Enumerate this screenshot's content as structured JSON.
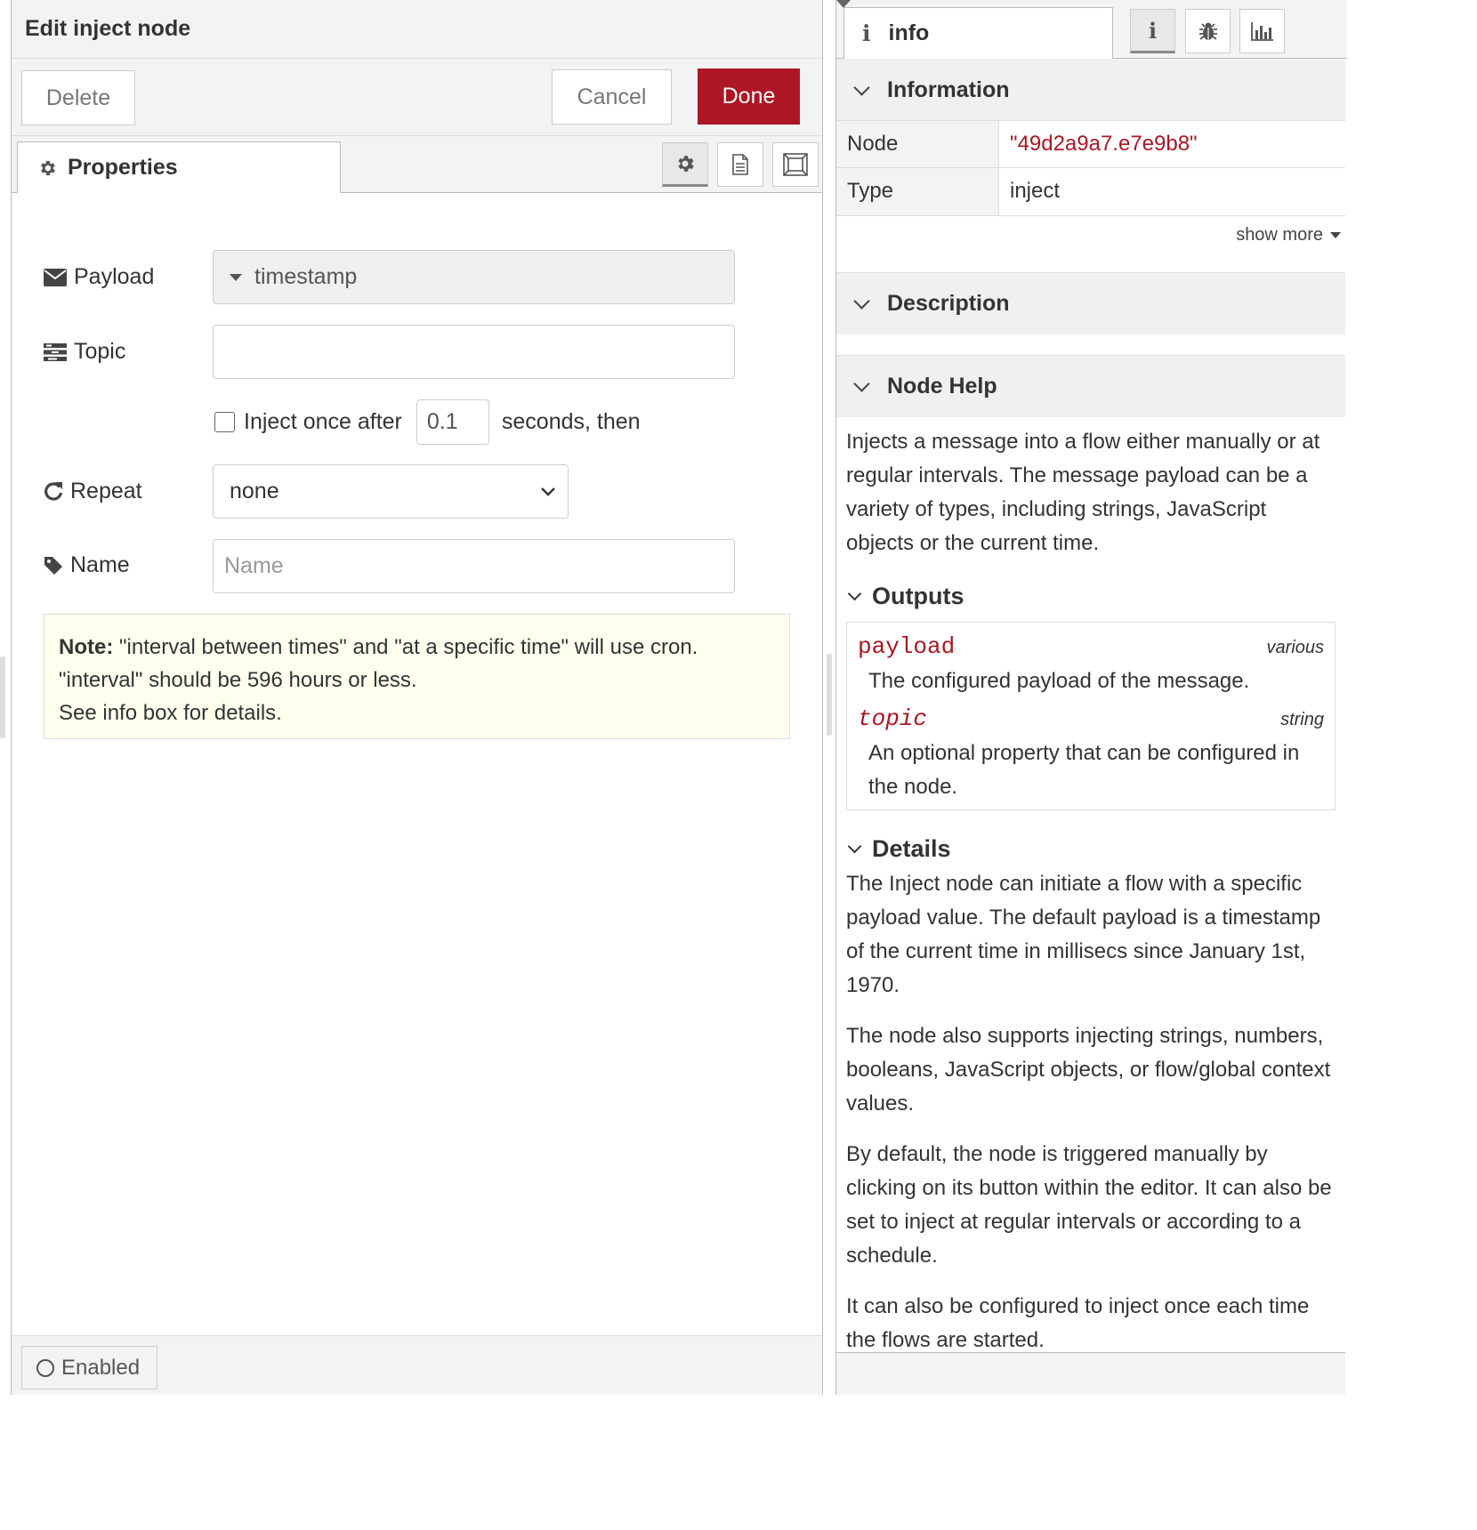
{
  "editor": {
    "title": "Edit inject node",
    "delete_label": "Delete",
    "cancel_label": "Cancel",
    "done_label": "Done",
    "tab_properties": "Properties",
    "form": {
      "payload_label": "Payload",
      "payload_value": "timestamp",
      "topic_label": "Topic",
      "topic_value": "",
      "inject_once_label": "Inject once after",
      "inject_once_checked": false,
      "inject_delay": "0.1",
      "inject_suffix": "seconds, then",
      "repeat_label": "Repeat",
      "repeat_value": "none",
      "name_label": "Name",
      "name_placeholder": "Name"
    },
    "note": {
      "bold": "Note:",
      "line1": " \"interval between times\" and \"at a specific time\" will use cron.",
      "line2": "\"interval\" should be 596 hours or less.",
      "line3": "See info box for details."
    },
    "enabled_label": "Enabled"
  },
  "sidebar": {
    "tab_label": "info",
    "information": {
      "heading": "Information",
      "node_key": "Node",
      "node_value": "\"49d2a9a7.e7e9b8\"",
      "type_key": "Type",
      "type_value": "inject",
      "show_more": "show more"
    },
    "description_heading": "Description",
    "help": {
      "heading": "Node Help",
      "intro": "Injects a message into a flow either manually or at regular intervals. The message payload can be a variety of types, including strings, JavaScript objects or the current time.",
      "outputs_heading": "Outputs",
      "outputs": [
        {
          "name": "payload",
          "type": "various",
          "desc": "The configured payload of the message."
        },
        {
          "name": "topic",
          "type": "string",
          "desc": "An optional property that can be configured in the node."
        }
      ],
      "details_heading": "Details",
      "details": [
        "The Inject node can initiate a flow with a specific payload value. The default payload is a timestamp of the current time in millisecs since January 1st, 1970.",
        "The node also supports injecting strings, numbers, booleans, JavaScript objects, or flow/global context values.",
        "By default, the node is triggered manually by clicking on its button within the editor. It can also be set to inject at regular intervals or according to a schedule.",
        "It can also be configured to inject once each time the flows are started."
      ]
    }
  },
  "colors": {
    "accent": "#ad1625",
    "panel": "#f3f3f3",
    "note_bg": "#ffffee"
  }
}
